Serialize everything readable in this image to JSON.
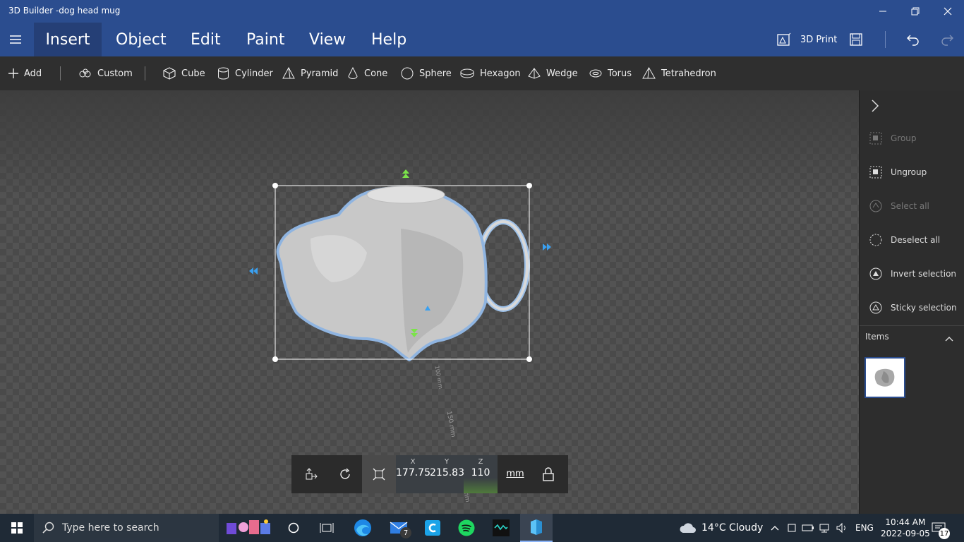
{
  "window": {
    "title": "3D Builder -dog head mug"
  },
  "menu": {
    "tabs": [
      "Insert",
      "Object",
      "Edit",
      "Paint",
      "View",
      "Help"
    ],
    "print_label": "3D Print"
  },
  "toolbar": {
    "add": "Add",
    "custom": "Custom",
    "shapes": [
      "Cube",
      "Cylinder",
      "Pyramid",
      "Cone",
      "Sphere",
      "Hexagon",
      "Wedge",
      "Torus",
      "Tetrahedron"
    ]
  },
  "right_panel": {
    "group": "Group",
    "ungroup": "Ungroup",
    "select_all": "Select all",
    "deselect_all": "Deselect all",
    "invert_selection": "Invert selection",
    "sticky_selection": "Sticky selection",
    "items_header": "Items"
  },
  "dimensions": {
    "x_label": "X",
    "x_value": "177.75",
    "y_label": "Y",
    "y_value": "215.83",
    "z_label": "Z",
    "z_value": "110",
    "unit": "mm"
  },
  "viewport": {
    "ruler_1": "100 mm",
    "ruler_2": "150 mm",
    "ruler_3": "mm"
  },
  "taskbar": {
    "search_placeholder": "Type here to search",
    "mail_badge": "7",
    "weather": "14°C  Cloudy",
    "lang": "ENG",
    "time": "10:44 AM",
    "date": "2022-09-05",
    "notif_count": "17"
  },
  "colors": {
    "accent": "#2b4d8f",
    "selection": "#8fb4e0",
    "gizmo_green": "#7be34a",
    "gizmo_blue": "#3aa0f0"
  }
}
